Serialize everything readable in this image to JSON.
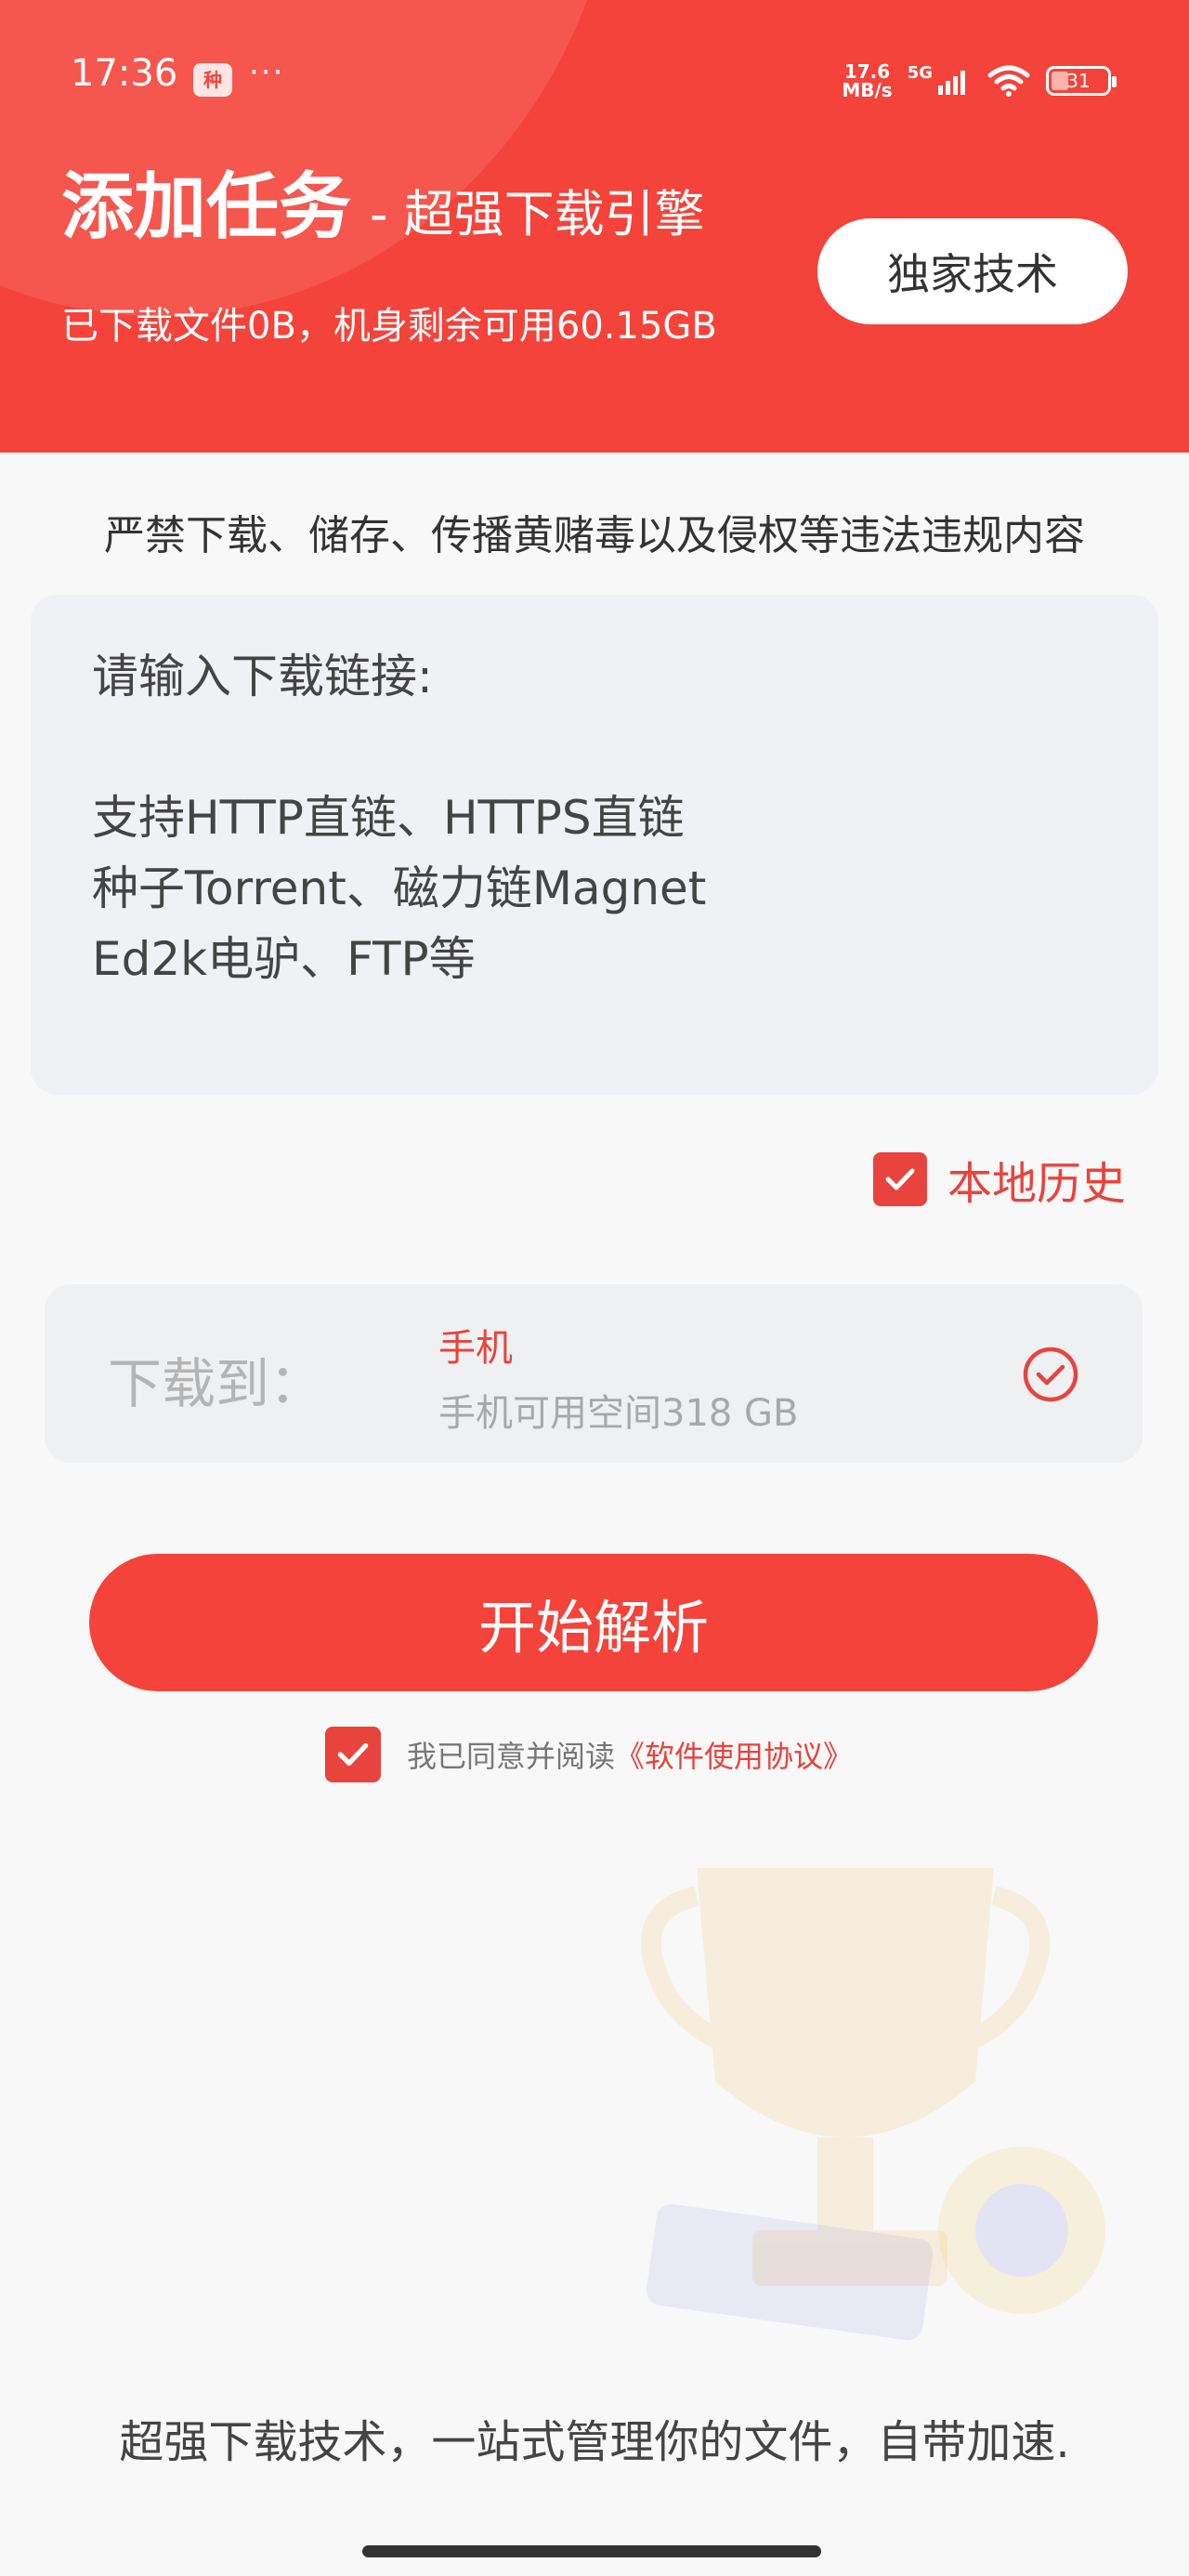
{
  "status_bar": {
    "time": "17:36",
    "notification_badge": "种",
    "more": "···",
    "net_speed_value": "17.6",
    "net_speed_unit": "MB/s",
    "network": "5G",
    "battery": "31"
  },
  "header": {
    "title": "添加任务",
    "subtitle": "- 超强下载引擎",
    "info": "已下载文件0B，机身剩余可用60.15GB",
    "tech_button": "独家技术"
  },
  "warning_text": "严禁下载、储存、传播黄赌毒以及侵权等违法违规内容",
  "link_input": {
    "placeholder": "请输入下载链接:\n\n 支持HTTP直链、HTTPS直链\n 种子Torrent、磁力链Magnet\n Ed2k电驴、FTP等"
  },
  "local_history": {
    "label": "本地历史",
    "checked": true
  },
  "destination": {
    "label": "下载到：",
    "title": "手机",
    "space": "手机可用空间318 GB"
  },
  "start_button": "开始解析",
  "agreement": {
    "checked": true,
    "prefix": "我已同意并阅读",
    "link": "《软件使用协议》"
  },
  "footer_text": "超强下载技术，一站式管理你的文件，自带加速.",
  "colors": {
    "accent": "#f4433a",
    "background": "#f8f8f8"
  }
}
